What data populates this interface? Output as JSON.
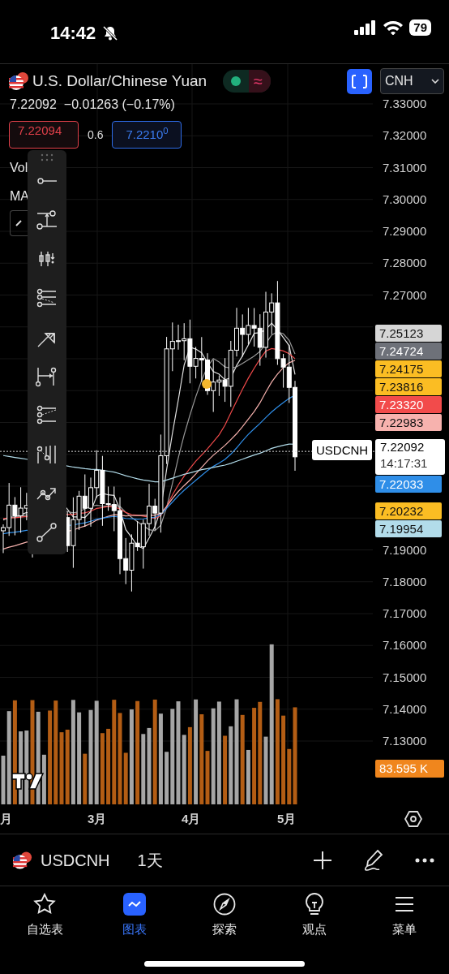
{
  "status_bar": {
    "time": "14:42",
    "battery": "79"
  },
  "header": {
    "title": "U.S. Dollar/Chinese Yuan",
    "status_glyph": "≈",
    "currency": "CNH"
  },
  "quote": {
    "price": "7.22092",
    "change": "−0.01263 (−0.17%)",
    "bid": "7.22094",
    "spread": "0.6",
    "ask": "7.2210$^{0}$"
  },
  "indicators": [
    "Vol",
    "MA"
  ],
  "price_axis": [
    "7.33000",
    "7.32000",
    "7.31000",
    "7.30000",
    "7.29000",
    "7.28000",
    "7.27000",
    "7.19000",
    "7.18000",
    "7.17000",
    "7.16000",
    "7.15000",
    "7.14000",
    "7.13000"
  ],
  "price_labels_upper": [
    {
      "value": "7.25123",
      "color": "#d6d6d6"
    },
    {
      "value": "7.24724",
      "color": "#6e7179"
    },
    {
      "value": "7.24175",
      "color": "#fbbd23"
    },
    {
      "value": "7.23816",
      "color": "#fbbd23"
    },
    {
      "value": "7.23320",
      "color": "#f24b4b"
    },
    {
      "value": "7.22983",
      "color": "#f7b2ae"
    }
  ],
  "last_price": {
    "symbol": "USDCNH",
    "value": "7.22092",
    "countdown": "14:17:31"
  },
  "price_labels_middle": [
    {
      "value": "7.22033",
      "color": "#2f8ee8"
    }
  ],
  "price_labels_lower": [
    {
      "value": "7.20232",
      "color": "#fbbd23"
    },
    {
      "value": "7.19954",
      "color": "#b2dcea"
    }
  ],
  "volume_label": "83.595 K",
  "time_axis": [
    "月",
    "3月",
    "4月",
    "5月"
  ],
  "symbol_bar": {
    "symbol": "USDCNH",
    "interval": "1天"
  },
  "nav": [
    {
      "label": "自选表",
      "selected": false
    },
    {
      "label": "图表",
      "selected": true
    },
    {
      "label": "探索",
      "selected": false
    },
    {
      "label": "观点",
      "selected": false
    },
    {
      "label": "菜单",
      "selected": false
    }
  ]
}
